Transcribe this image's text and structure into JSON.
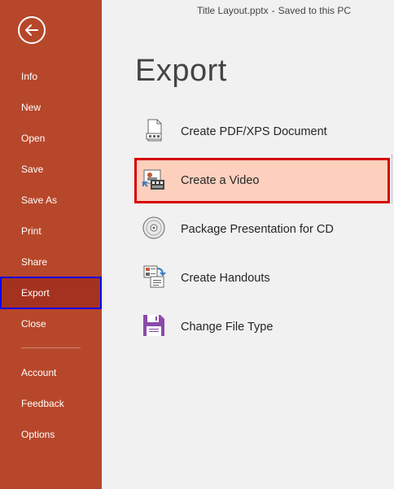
{
  "titlebar": {
    "filename": "Title Layout.pptx",
    "separator": "-",
    "status": "Saved to this PC"
  },
  "sidebar": {
    "back_icon": "arrow-left-circle-icon",
    "items": [
      {
        "label": "Info"
      },
      {
        "label": "New"
      },
      {
        "label": "Open"
      },
      {
        "label": "Save"
      },
      {
        "label": "Save As"
      },
      {
        "label": "Print"
      },
      {
        "label": "Share"
      },
      {
        "label": "Export",
        "selected": true
      },
      {
        "label": "Close"
      }
    ],
    "bottom_items": [
      {
        "label": "Account"
      },
      {
        "label": "Feedback"
      },
      {
        "label": "Options"
      }
    ]
  },
  "main": {
    "title": "Export",
    "options": [
      {
        "label": "Create PDF/XPS Document",
        "icon": "pdf-document-icon"
      },
      {
        "label": "Create a Video",
        "icon": "video-icon",
        "selected": true
      },
      {
        "label": "Package Presentation for CD",
        "icon": "cd-icon"
      },
      {
        "label": "Create Handouts",
        "icon": "handouts-icon"
      },
      {
        "label": "Change File Type",
        "icon": "save-file-type-icon"
      }
    ]
  },
  "colors": {
    "sidebar_bg": "#b7472a",
    "sidebar_selected_bg": "#a5321f",
    "selected_option_bg": "#fcd0bd",
    "highlight_red": "#d60000",
    "highlight_blue": "#0000ff"
  }
}
